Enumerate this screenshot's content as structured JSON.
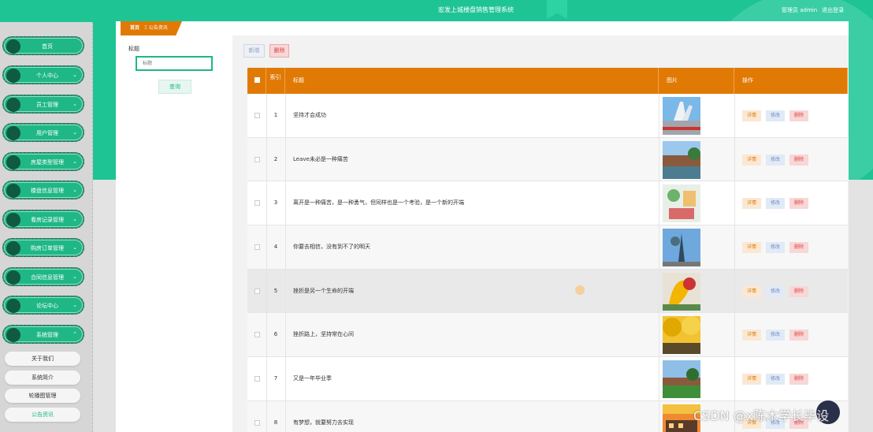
{
  "header": {
    "system_title": "宏发上城楼盘销售管理系统",
    "user_label": "管理员 admin",
    "logout_label": "退出登录"
  },
  "sidebar": {
    "items": [
      {
        "label": "首页",
        "has_arrow": false
      },
      {
        "label": "个人中心",
        "has_arrow": true
      },
      {
        "label": "员工管理",
        "has_arrow": true
      },
      {
        "label": "用户管理",
        "has_arrow": true
      },
      {
        "label": "房屋类型管理",
        "has_arrow": true
      },
      {
        "label": "楼盘信息管理",
        "has_arrow": true
      },
      {
        "label": "看房记录管理",
        "has_arrow": true
      },
      {
        "label": "购房订单管理",
        "has_arrow": true
      },
      {
        "label": "合同信息管理",
        "has_arrow": true
      },
      {
        "label": "论坛中心",
        "has_arrow": true
      },
      {
        "label": "系统管理",
        "has_arrow": true,
        "expanded": true
      }
    ],
    "sub_items": [
      {
        "label": "关于我们",
        "active": false
      },
      {
        "label": "系统简介",
        "active": false
      },
      {
        "label": "轮播图管理",
        "active": false
      },
      {
        "label": "公告资讯",
        "active": true
      }
    ]
  },
  "breadcrumb": {
    "home": "首页",
    "current": "公告资讯"
  },
  "filter": {
    "label": "标题",
    "placeholder": "标题",
    "search_label": "查询"
  },
  "toolbar": {
    "add_label": "新增",
    "delete_label": "删除"
  },
  "table": {
    "columns": {
      "index": "索引",
      "title": "标题",
      "image": "图片",
      "actions": "操作"
    },
    "rows": [
      {
        "index": "1",
        "title": "坚持才会成功",
        "image": "sculpture-plaza-photo"
      },
      {
        "index": "2",
        "title": "Leave未必是一种痛苦",
        "image": "campus-lake-photo"
      },
      {
        "index": "3",
        "title": "离开是一种痛苦，是一种勇气，但同样也是一个考验，是一个新的开端",
        "image": "illustration-photo"
      },
      {
        "index": "4",
        "title": "你要去相信，没有到不了的明天",
        "image": "statue-photo"
      },
      {
        "index": "5",
        "title": "挫折是另一个生命的开端",
        "image": "colorful-sculpture-photo"
      },
      {
        "index": "6",
        "title": "挫折路上，坚持常在心间",
        "image": "ginkgo-trees-photo"
      },
      {
        "index": "7",
        "title": "又是一年毕业季",
        "image": "campus-lawn-photo"
      },
      {
        "index": "8",
        "title": "有梦想，就要努力去实现",
        "image": "sunset-building-photo"
      }
    ],
    "action_labels": {
      "detail": "详情",
      "edit": "修改",
      "delete": "删除"
    }
  },
  "watermark": "CSDN @x陈木学长毕设",
  "colors": {
    "primary_green": "#1fc495",
    "orange": "#e07a05"
  }
}
